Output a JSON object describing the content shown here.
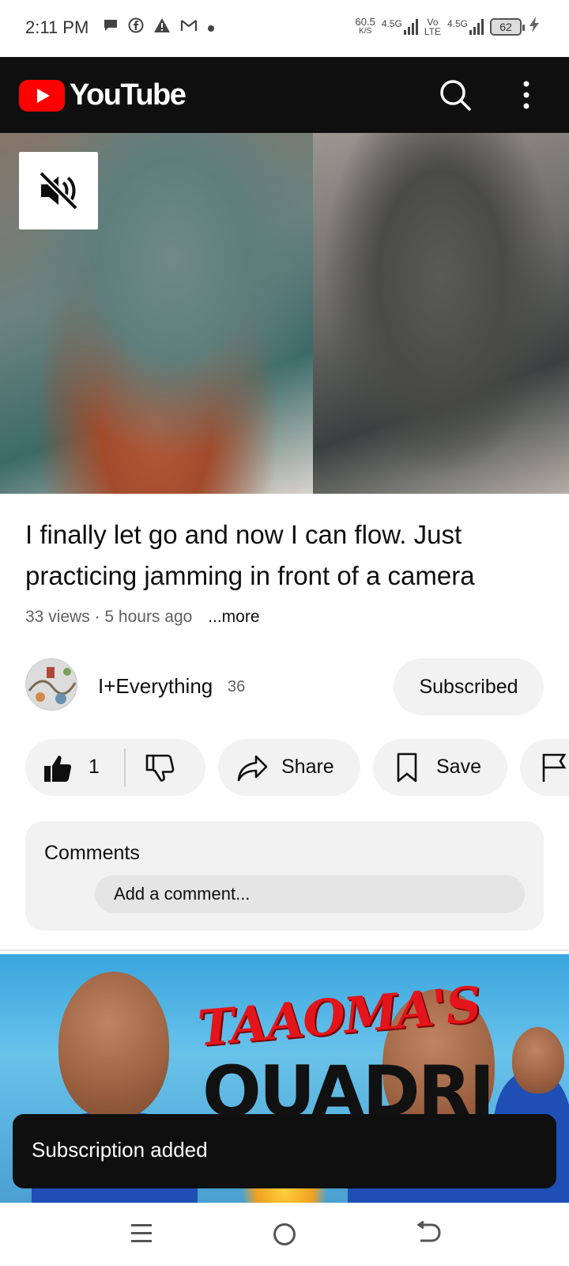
{
  "status_bar": {
    "time": "2:11 PM",
    "net_speed_value": "60.5",
    "net_speed_unit": "K/S",
    "network1": "4.5G",
    "volte_top": "Vo",
    "volte_bottom": "LTE",
    "network2": "4.5G",
    "battery": "62",
    "left_icons": [
      "chat-bubble-icon",
      "facebook-icon",
      "alert-icon",
      "gmail-icon",
      "dot-icon"
    ]
  },
  "header": {
    "brand": "YouTube",
    "brand_color": "#ff0000",
    "icons": [
      "search-icon",
      "more-vert-icon"
    ]
  },
  "player": {
    "icons": [
      "volume-off-icon"
    ]
  },
  "video": {
    "title": "I finally let go and now I can flow. Just practicing jamming in front of a camera",
    "views": "33 views",
    "separator": "·",
    "age": "5 hours ago",
    "more": "...more"
  },
  "channel": {
    "name": "I+Everything",
    "subscriber_count": "36",
    "subscribe_label": "Subscribed"
  },
  "actions": {
    "like_count": "1",
    "share_label": "Share",
    "save_label": "Save",
    "icons": [
      "thumbs-up-icon",
      "thumbs-down-icon",
      "share-icon",
      "bookmark-icon",
      "flag-icon"
    ]
  },
  "comments": {
    "title": "Comments",
    "placeholder": "Add a comment..."
  },
  "next_video": {
    "thumb_text_1": "TAAOMA'S",
    "thumb_text_2": "QUADRI"
  },
  "toast": {
    "message": "Subscription added"
  },
  "system_nav": {
    "icons": [
      "menu-icon",
      "home-icon",
      "back-icon"
    ]
  }
}
